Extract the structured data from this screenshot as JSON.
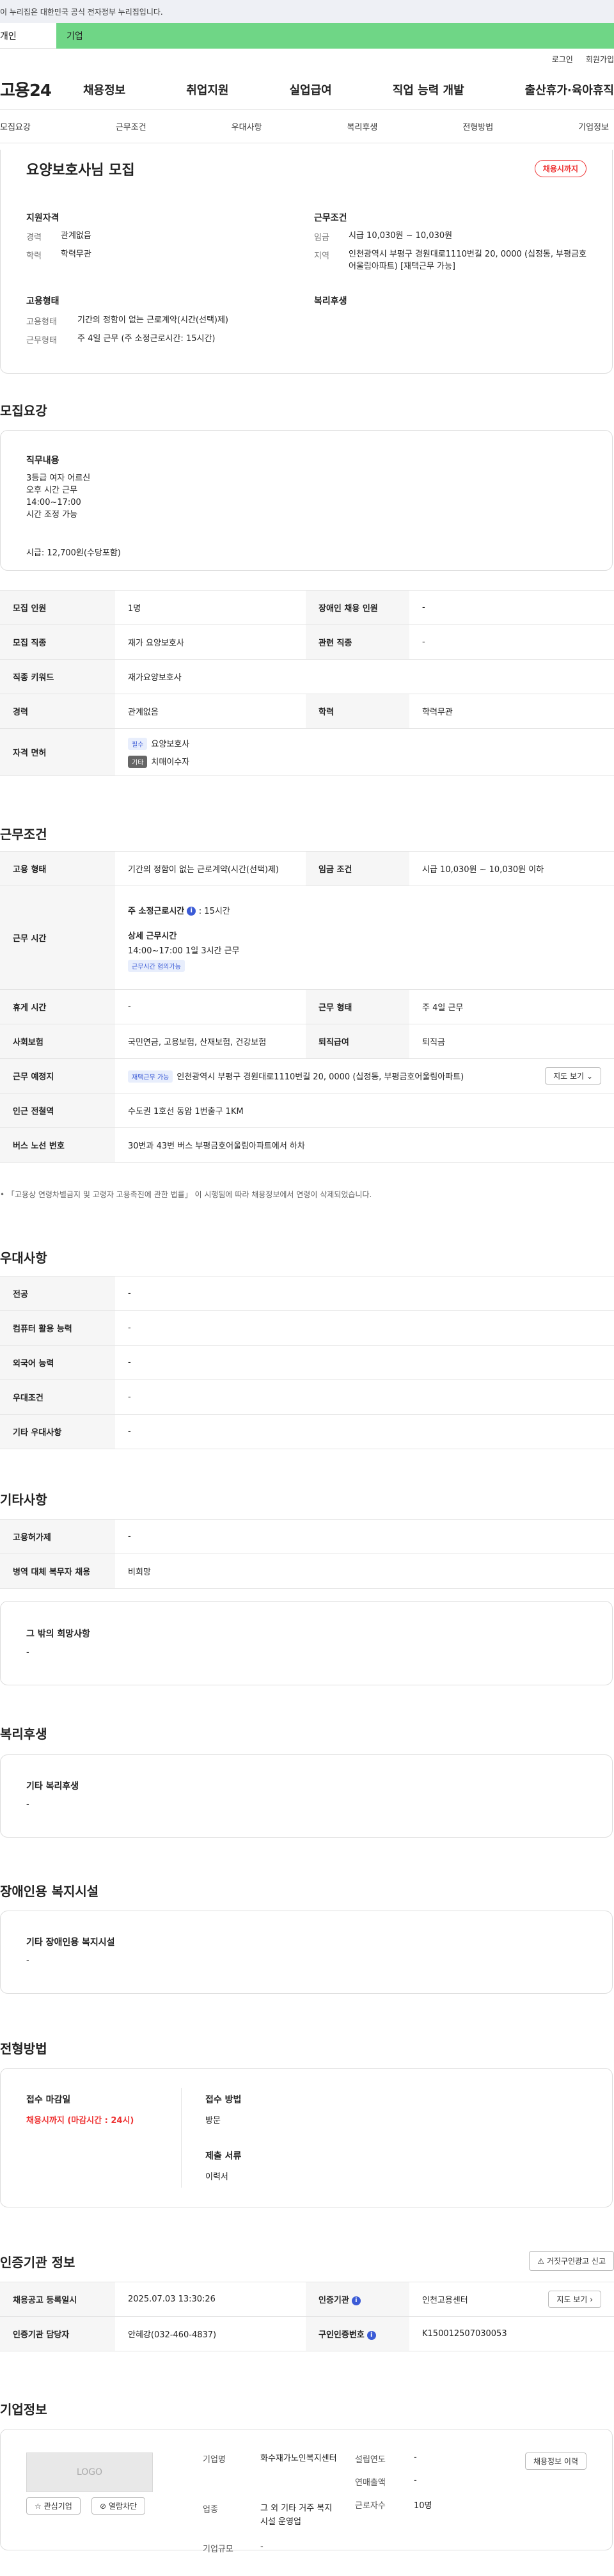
{
  "gov_bar": {
    "text": "이 누리집은 대한민국 공식 전자정부 누리집입니다."
  },
  "tabs": {
    "individual": "개인",
    "corporate": "기업"
  },
  "util": {
    "login": "로그인",
    "signup": "회원가입"
  },
  "logo": "고용24",
  "gnb": [
    "채용정보",
    "취업지원",
    "실업급여",
    "직업 능력 개발",
    "출산휴가·육아휴직"
  ],
  "sub_nav": [
    "모집요강",
    "근무조건",
    "우대사항",
    "복리후생",
    "전형방법",
    "기업정보"
  ],
  "summary": {
    "title": "요양보호사님 모집",
    "badge": "채용시까지",
    "qual_title": "지원자격",
    "qual": [
      {
        "k": "경력",
        "v": "관계없음"
      },
      {
        "k": "학력",
        "v": "학력무관"
      }
    ],
    "cond_title": "근무조건",
    "cond": [
      {
        "k": "임금",
        "v": "시급 10,030원 ~ 10,030원"
      },
      {
        "k": "지역",
        "v": "인천광역시 부평구 경원대로1110번길 20, 0000 (십정동, 부평금호어울림아파트) [재택근무 가능]"
      }
    ],
    "emp_title": "고용형태",
    "emp": [
      {
        "k": "고용형태",
        "v": "기간의 정함이 없는 근로계약(시간(선택)제)"
      },
      {
        "k": "근무형태",
        "v": "주 4일 근무 (주 소정근로시간: 15시간)"
      }
    ],
    "welfare_title": "복리후생"
  },
  "recruit": {
    "heading": "모집요강",
    "duty_title": "직무내용",
    "duty_lines": [
      "3등급 여자 어르신",
      "오후 시간 근무",
      "14:00~17:00",
      "시간 조정 가능"
    ],
    "duty_pay": "시급: 12,700원(수당포함)",
    "labels": {
      "headcount": "모집 인원",
      "disabled": "장애인 채용 인원",
      "job": "모집 직종",
      "related": "관련 직종",
      "keyword": "직종 키워드",
      "career": "경력",
      "edu": "학력",
      "license": "자격 면허"
    },
    "values": {
      "headcount": "1명",
      "disabled": "-",
      "job": "재가 요양보호사",
      "related": "-",
      "keyword": "재가요양보호사",
      "career": "관계없음",
      "edu": "학력무관"
    },
    "licenses": [
      {
        "tag": "필수",
        "name": "요양보호사"
      },
      {
        "tag": "기타",
        "name": "치매이수자"
      }
    ]
  },
  "workcond": {
    "heading": "근무조건",
    "labels": {
      "emp_type": "고용 형태",
      "wage": "임금 조건",
      "work_time": "근무 시간",
      "break": "휴게 시간",
      "work_form": "근무 형태",
      "insurance": "사회보험",
      "severance": "퇴직급여",
      "location": "근무 예정지",
      "station": "인근 전철역",
      "bus": "버스 노선 번호"
    },
    "values": {
      "emp_type": "기간의 정함이 없는 근로계약(시간(선택)제)",
      "wage": "시급 10,030원 ~ 10,030원 이하",
      "weekly_hours_label": "주 소정근로시간",
      "weekly_hours": ": 15시간",
      "detail_label": "상세 근무시간",
      "detail": "14:00~17:00 1일 3시간 근무",
      "detail_chip": "근무시간 협의가능",
      "break": "-",
      "work_form": "주 4일 근무",
      "insurance": "국민연금, 고용보험, 산재보험, 건강보험",
      "severance": "퇴직금",
      "location_chip": "재택근무 가능",
      "location": "인천광역시 부평구 경원대로1110번길 20, 0000 (십정동, 부평금호어울림아파트)",
      "map_button": "지도 보기",
      "station": "수도권 1호선 동암 1번출구 1KM",
      "bus": "30번과 43번 버스 부평금호어울림아파트에서 하차"
    },
    "note": "「고용상 연령차별금지 및 고령자 고용촉진에 관한 법률」 이 시행됨에 따라 채용정보에서 연령이 삭제되었습니다."
  },
  "prefer": {
    "heading": "우대사항",
    "rows": [
      {
        "label": "전공",
        "value": "-"
      },
      {
        "label": "컴퓨터 활용 능력",
        "value": "-"
      },
      {
        "label": "외국어 능력",
        "value": "-"
      },
      {
        "label": "우대조건",
        "value": "-"
      },
      {
        "label": "기타 우대사항",
        "value": "-"
      }
    ]
  },
  "etc": {
    "heading": "기타사항",
    "rows": [
      {
        "label": "고용허가제",
        "value": "-"
      },
      {
        "label": "병역 대체 복무자 채용",
        "value": "비희망"
      }
    ],
    "other_title": "그 밖의 희망사항",
    "other_value": "-"
  },
  "welfare": {
    "heading": "복리후생",
    "title": "기타 복리후생",
    "value": "-"
  },
  "disabled_fac": {
    "heading": "장애인용 복지시설",
    "title": "기타 장애인용 복지시설",
    "value": "-"
  },
  "selection": {
    "heading": "전형방법",
    "deadline_title": "접수 마감일",
    "deadline": "채용시까지 (마감시간 : 24시)",
    "method_title": "접수 방법",
    "method": "방문",
    "docs_title": "제출 서류",
    "docs": "이력서"
  },
  "cert": {
    "heading": "인증기관 정보",
    "report_button": "거짓구인광고 신고",
    "labels": {
      "reg_date": "채용공고 등록일시",
      "agency": "인증기관",
      "manager": "인증기관 담당자",
      "job_no": "구인인증번호"
    },
    "values": {
      "reg_date": "2025.07.03 13:30:26",
      "agency": "인천고용센터",
      "manager": "안혜강(032-460-4837)",
      "job_no": "K150012507030053"
    },
    "map_button": "지도 보기"
  },
  "company": {
    "heading": "기업정보",
    "logo_text": "LOGO",
    "interest_button": "관심기업",
    "block_button": "열람차단",
    "history_button": "채용정보 이력",
    "labels": {
      "name": "기업명",
      "founded": "설립연도",
      "revenue": "연매출액",
      "industry": "업종",
      "employees": "근로자수",
      "scale": "기업규모"
    },
    "values": {
      "name": "화수재가노인복지센터",
      "founded": "-",
      "revenue": "-",
      "industry": "그 외 기타 거주 복지시설 운영업",
      "employees": "10명",
      "scale": "-"
    }
  }
}
